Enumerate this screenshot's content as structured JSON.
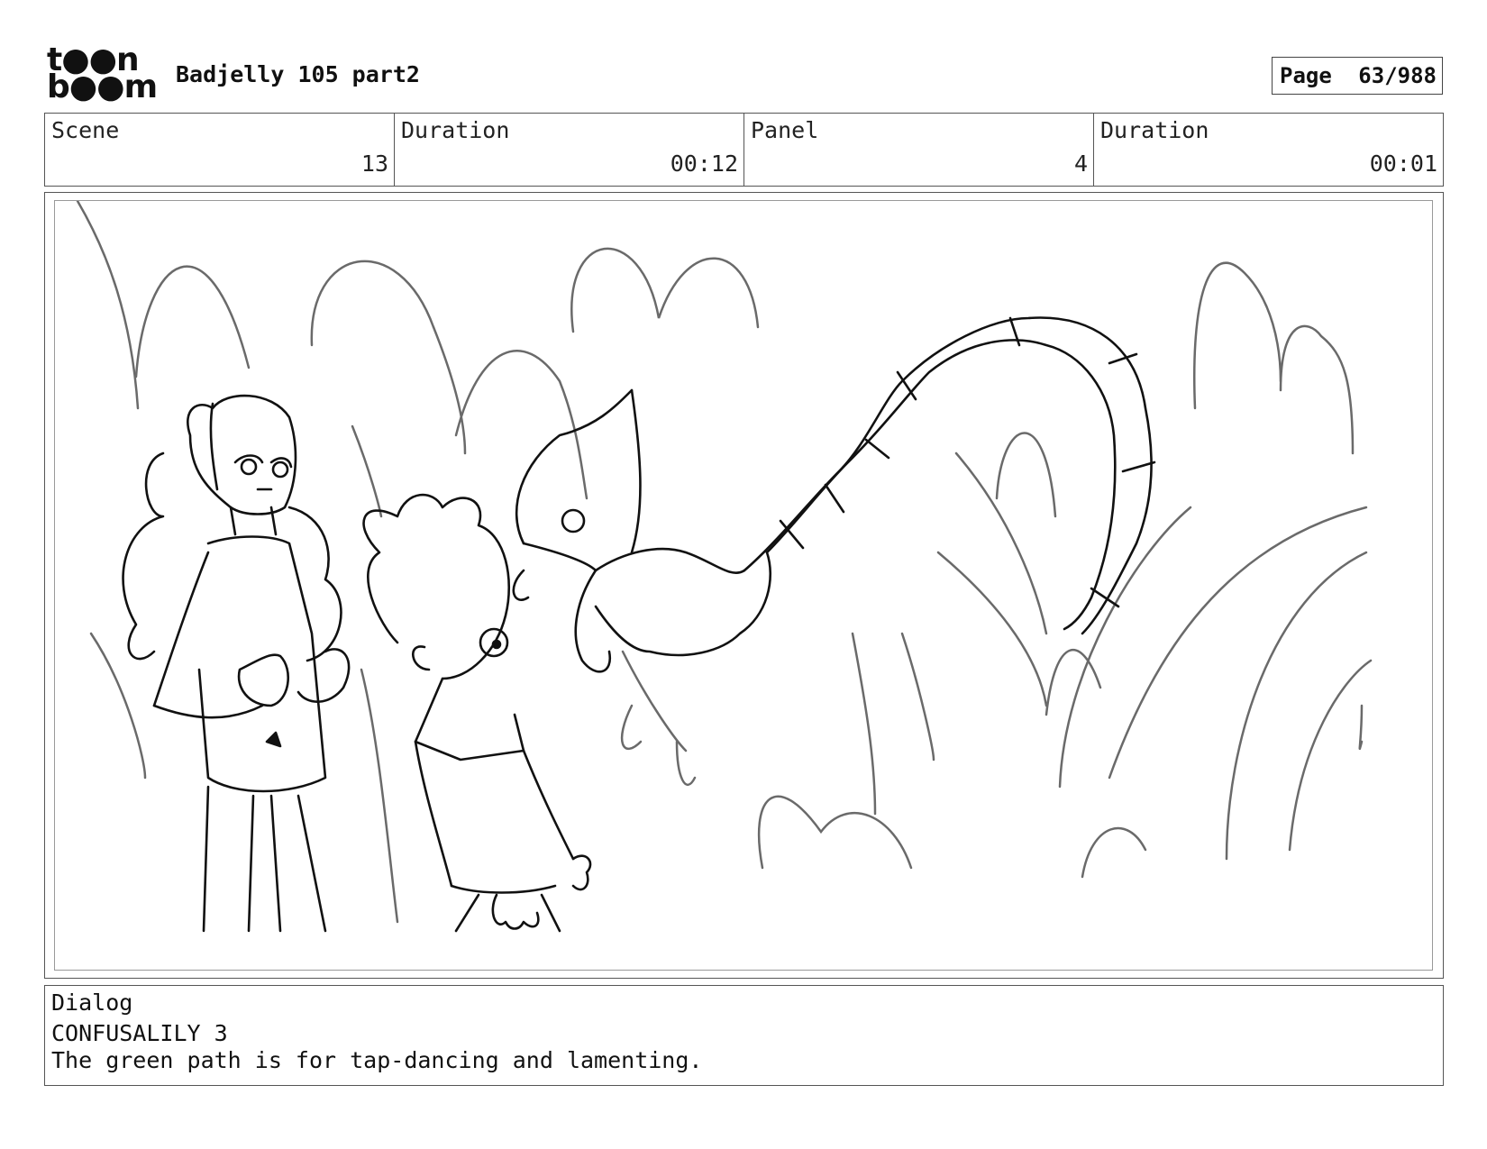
{
  "logo": {
    "line1": "t●●n",
    "line2": "b●●m"
  },
  "header": {
    "title": "Badjelly 105 part2"
  },
  "page": {
    "label": "Page",
    "value": "63/988"
  },
  "info": {
    "scene_label": "Scene",
    "scene_value": "13",
    "duration_label": "Duration",
    "duration_value": "00:12",
    "panel_label": "Panel",
    "panel_value": "4",
    "panel_duration_label": "Duration",
    "panel_duration_value": "00:01"
  },
  "dialog": {
    "label": "Dialog",
    "speaker": "CONFUSALILY 3",
    "line": "The green path is for tap-dancing and lamenting."
  }
}
